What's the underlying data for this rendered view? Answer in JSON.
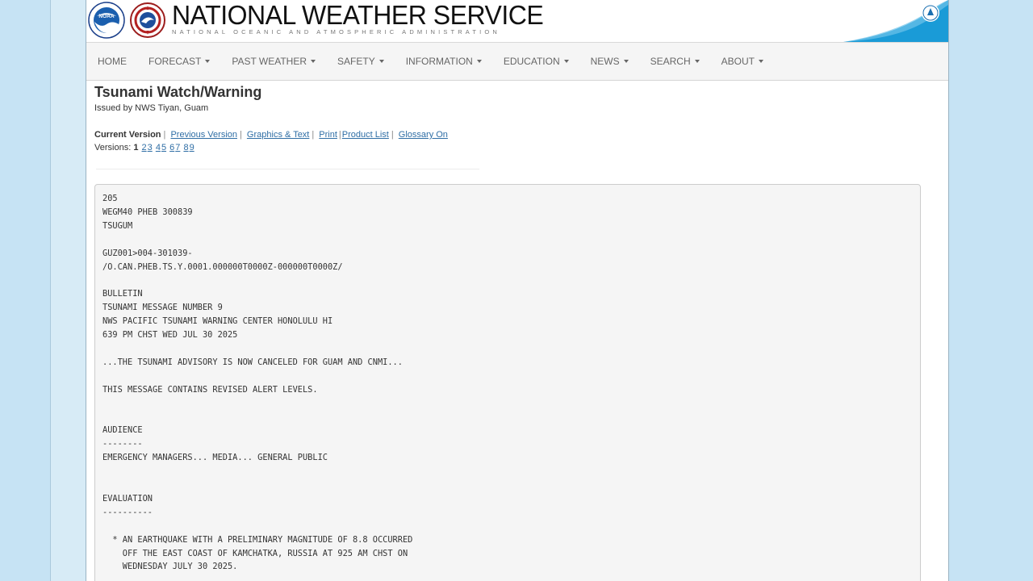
{
  "header": {
    "title": "NATIONAL WEATHER SERVICE",
    "subtitle": "NATIONAL OCEANIC AND ATMOSPHERIC ADMINISTRATION",
    "noaa_logo_text": "NOAA"
  },
  "nav": {
    "items": [
      {
        "label": "HOME",
        "dropdown": false
      },
      {
        "label": "FORECAST",
        "dropdown": true
      },
      {
        "label": "PAST WEATHER",
        "dropdown": true
      },
      {
        "label": "SAFETY",
        "dropdown": true
      },
      {
        "label": "INFORMATION",
        "dropdown": true
      },
      {
        "label": "EDUCATION",
        "dropdown": true
      },
      {
        "label": "NEWS",
        "dropdown": true
      },
      {
        "label": "SEARCH",
        "dropdown": true
      },
      {
        "label": "ABOUT",
        "dropdown": true
      }
    ]
  },
  "page": {
    "heading": "Tsunami Watch/Warning",
    "issued_by": "Issued by NWS Tiyan, Guam"
  },
  "version_bar": {
    "current_label": "Current Version",
    "previous_label": "Previous Version",
    "graphics_label": "Graphics & Text",
    "print_label": "Print",
    "product_list_label": "Product List",
    "glossary_label": "Glossary On",
    "versions_label": "Versions:",
    "current_version": "1",
    "other_versions": [
      "2",
      "3",
      "4",
      "5",
      "6",
      "7",
      "8",
      "9"
    ]
  },
  "product": {
    "lines": [
      "205",
      "WEGM40 PHEB 300839",
      "TSUGUM",
      "",
      "GUZ001>004-301039-",
      "/O.CAN.PHEB.TS.Y.0001.000000T0000Z-000000T0000Z/",
      "",
      "BULLETIN",
      "TSUNAMI MESSAGE NUMBER 9",
      "NWS PACIFIC TSUNAMI WARNING CENTER HONOLULU HI",
      "639 PM CHST WED JUL 30 2025",
      "",
      "...THE TSUNAMI ADVISORY IS NOW CANCELED FOR GUAM AND CNMI...",
      "",
      "THIS MESSAGE CONTAINS REVISED ALERT LEVELS.",
      "",
      "",
      "AUDIENCE",
      "--------",
      "EMERGENCY MANAGERS... MEDIA... GENERAL PUBLIC",
      "",
      "",
      "EVALUATION",
      "----------",
      "",
      "  * AN EARTHQUAKE WITH A PRELIMINARY MAGNITUDE OF 8.8 OCCURRED",
      "    OFF THE EAST COAST OF KAMCHATKA, RUSSIA AT 925 AM CHST ON",
      "    WEDNESDAY JULY 30 2025."
    ]
  },
  "colors": {
    "background": "#c6e3f4",
    "link": "#2f6ea5",
    "nav_bg": "#f5f5f5",
    "product_bg": "#f5f5f5",
    "swoosh": "#1a9bd7"
  }
}
